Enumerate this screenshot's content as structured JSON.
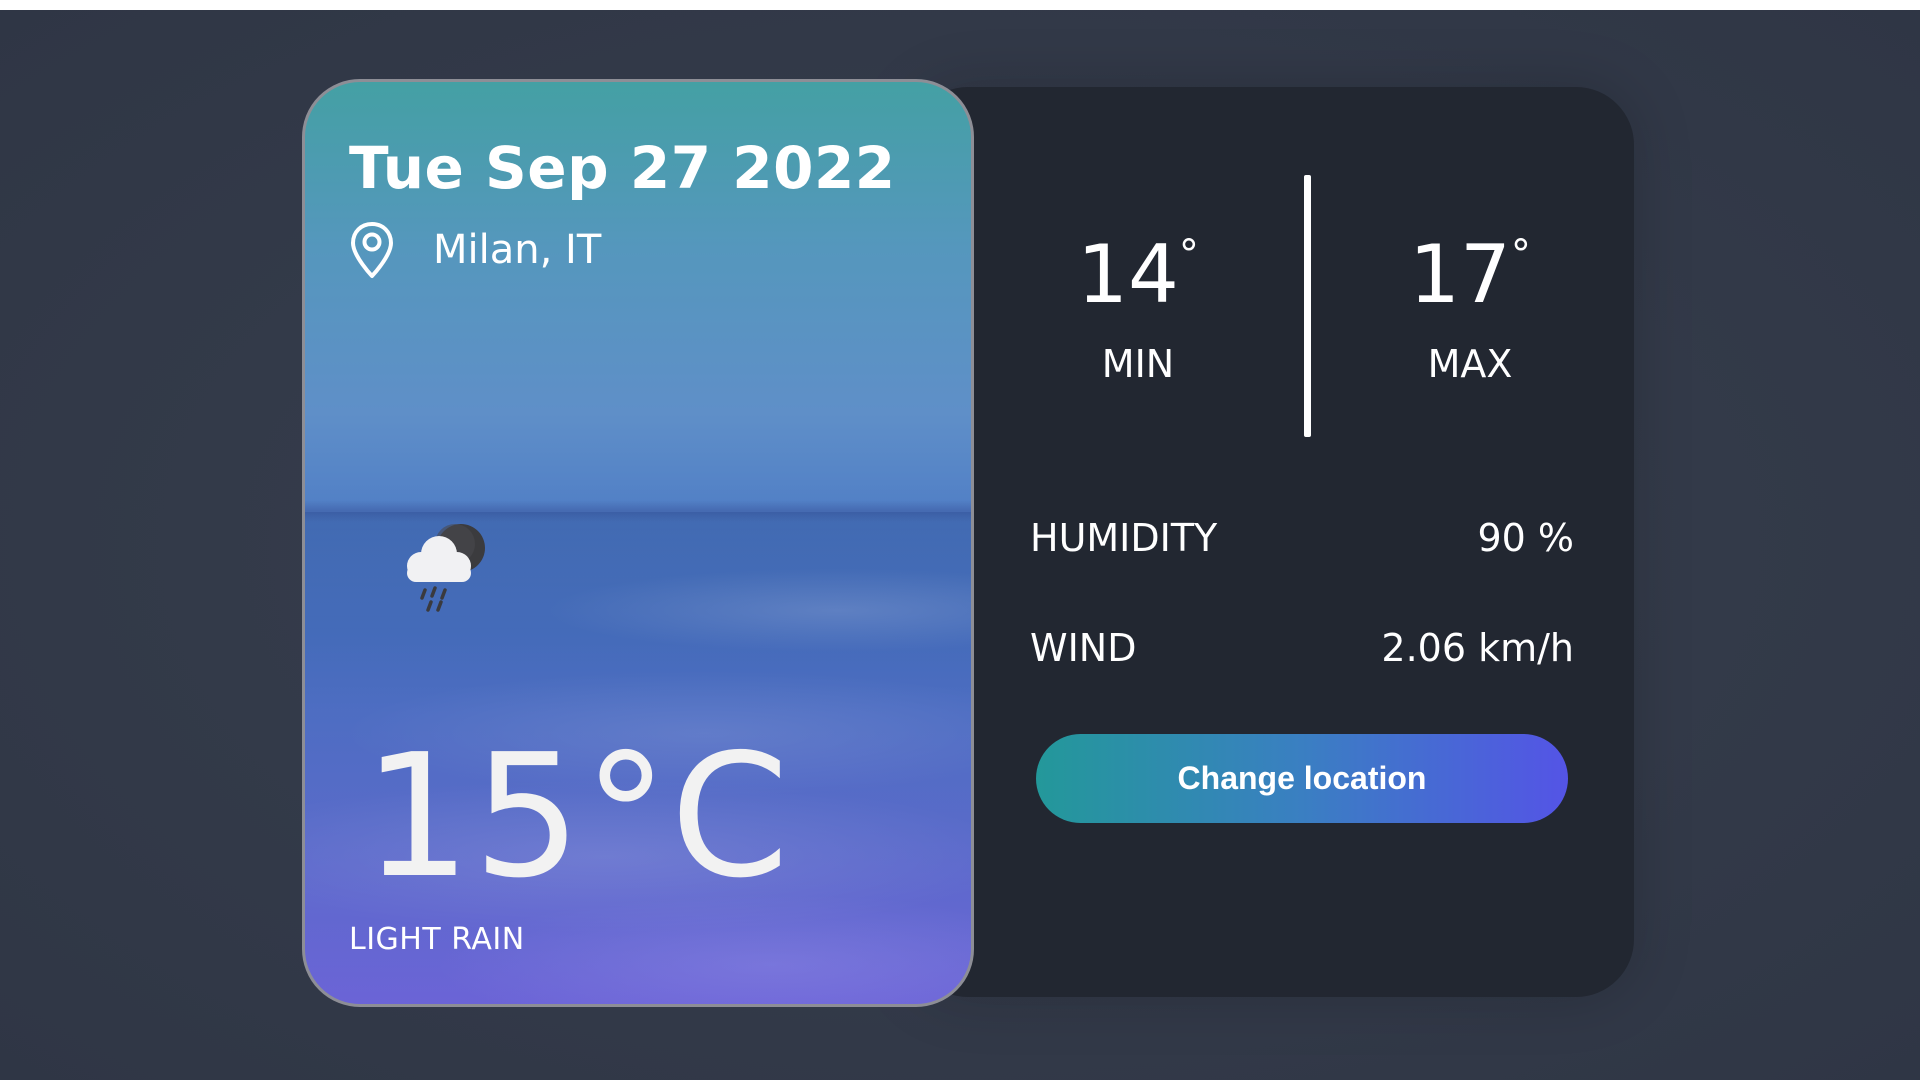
{
  "weather_card": {
    "date": "Tue Sep 27 2022",
    "location": "Milan, IT",
    "condition_icon": "cloud-rain-moon-icon",
    "temperature": "15°C",
    "description": "LIGHT RAIN"
  },
  "min_max": {
    "min_value": "14",
    "min_unit": "°",
    "min_label": "MIN",
    "max_value": "17",
    "max_unit": "°",
    "max_label": "MAX"
  },
  "stats": {
    "humidity_label": "HUMIDITY",
    "humidity_value": "90 %",
    "wind_label": "WIND",
    "wind_value": "2.06 km/h"
  },
  "actions": {
    "change_location_label": "Change location"
  },
  "colors": {
    "background": "#343b4a",
    "panel": "#222731",
    "button_gradient_start": "#23989a",
    "button_gradient_end": "#5454e6"
  }
}
